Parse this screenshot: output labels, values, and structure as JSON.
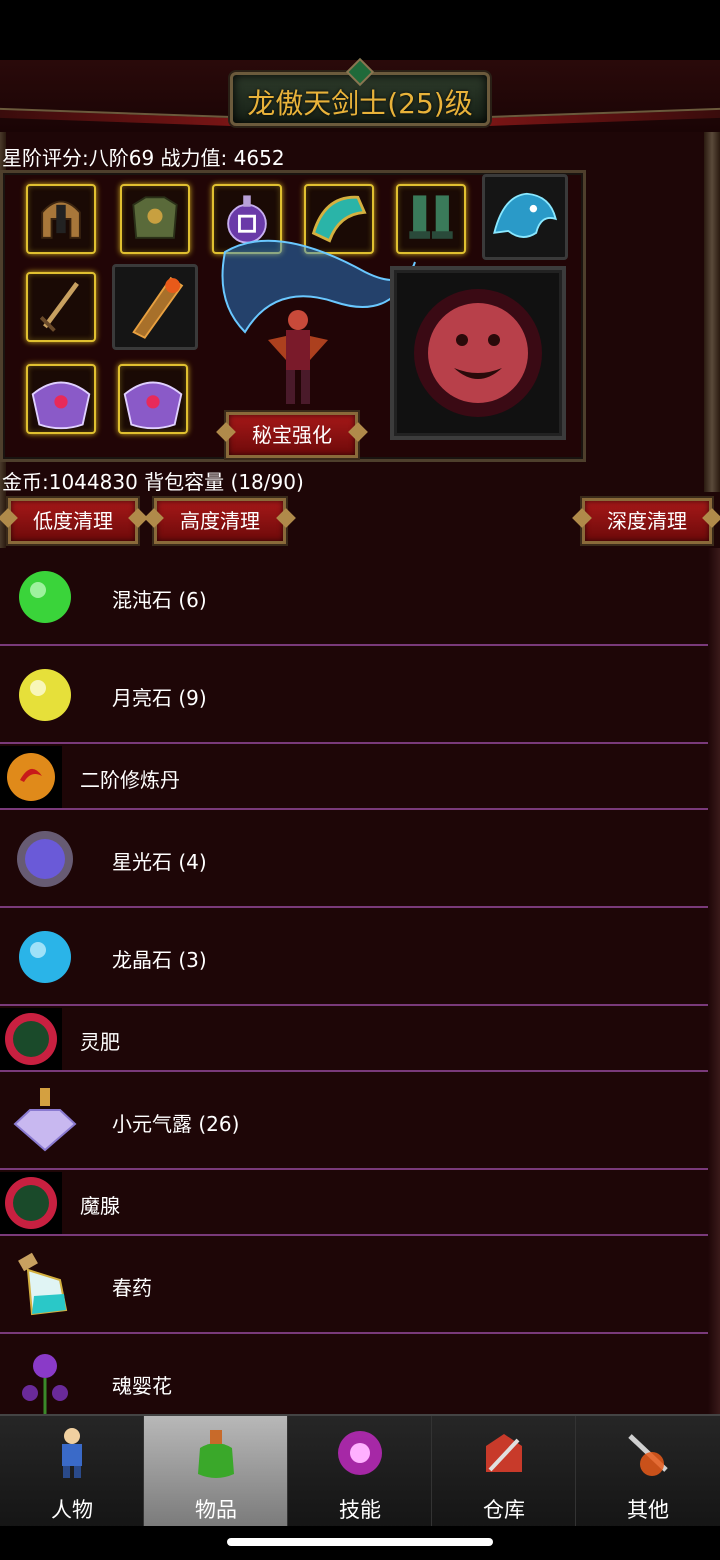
{
  "header": {
    "title": "龙傲天剑士(25)级"
  },
  "character": {
    "rating_text": "星阶评分:八阶69 战力值: 4652",
    "equipment_slots": [
      "helmet-icon",
      "armor-icon",
      "amulet-icon",
      "shoulder-icon",
      "boots-icon",
      "mount-icon",
      "sword-icon",
      "weapon-icon",
      "ring-icon",
      "ring-icon"
    ],
    "treasure_button": "秘宝强化"
  },
  "bag": {
    "info_text": "金币:1044830 背包容量 (18/90)",
    "buttons": {
      "low_clean": "低度清理",
      "high_clean": "高度清理",
      "deep_clean": "深度清理"
    }
  },
  "items": [
    {
      "label": "混沌石 (6)",
      "icon": "green-orb-icon",
      "color": "#3ad43a"
    },
    {
      "label": "月亮石 (9)",
      "icon": "yellow-orb-icon",
      "color": "#e6e03a"
    },
    {
      "label": "二阶修炼丹",
      "icon": "pill-icon",
      "color": "#e08a1a"
    },
    {
      "label": "星光石 (4)",
      "icon": "purple-orb-icon",
      "color": "#6a5ad8"
    },
    {
      "label": "龙晶石 (3)",
      "icon": "blue-orb-icon",
      "color": "#2ab4e8"
    },
    {
      "label": "灵肥",
      "icon": "dark-orb-icon",
      "color": "#c82040"
    },
    {
      "label": "小元气露",
      "icon": "diamond-bottle-icon",
      "label_full": "小元气露 (26)"
    },
    {
      "label": "魔腺",
      "icon": "dark-orb-icon",
      "color": "#c82040"
    },
    {
      "label": "春药",
      "icon": "potion-bottle-icon"
    },
    {
      "label": "魂婴花",
      "icon": "flower-icon"
    }
  ],
  "tabs": [
    {
      "label": "人物",
      "icon": "character-icon"
    },
    {
      "label": "物品",
      "icon": "items-bag-icon",
      "active": true
    },
    {
      "label": "技能",
      "icon": "skill-icon"
    },
    {
      "label": "仓库",
      "icon": "warehouse-icon"
    },
    {
      "label": "其他",
      "icon": "other-icon"
    }
  ],
  "colors": {
    "title_gold": "#e8b23a",
    "panel_bg": "#1e0607",
    "divider_purple": "#7a3a7a",
    "button_red": "#a51818"
  }
}
